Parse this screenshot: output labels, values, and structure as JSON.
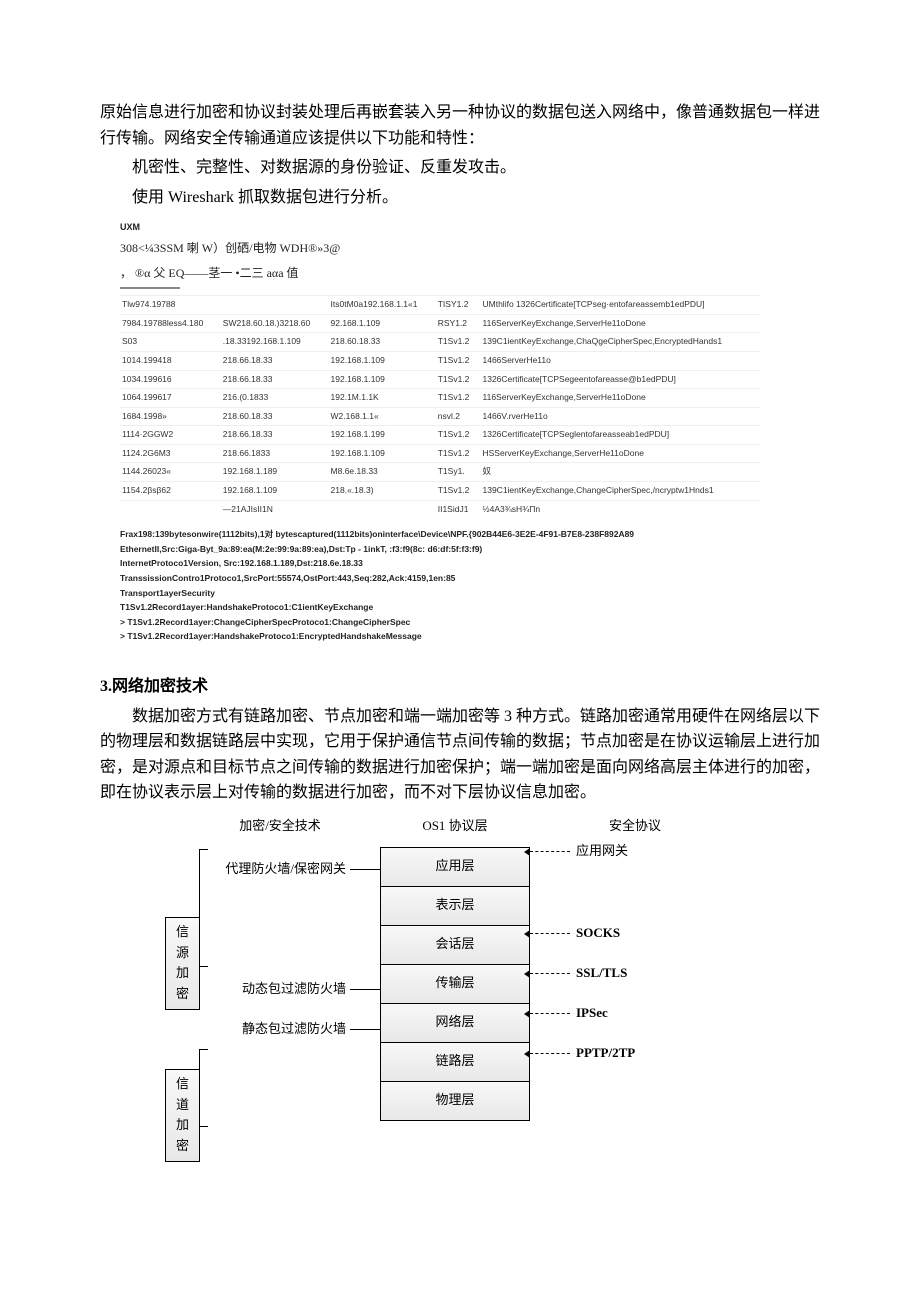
{
  "intro": {
    "p1": "原始信息进行加密和协议封装处理后再嵌套装入另一种协议的数据包送入网络中，像普通数据包一样进行传输。网络安全传输通道应该提供以下功能和特性：",
    "p2": "机密性、完整性、对数据源的身份验证、反重发攻击。",
    "p3": "使用 Wireshark 抓取数据包进行分析。"
  },
  "wireshark": {
    "top": "UXM",
    "toolbar": "308<¼3SSM 喇 W）创硒/电物 WDH®»3@",
    "filter": "， ®α 父 EQ——茎一 •二三 aαa 值",
    "packets": [
      {
        "no": "Tlw974.19788",
        "src": "",
        "dst": "Its0tM0a192.168.1.1«1",
        "proto": "TISY1.2",
        "len": "",
        "info": "UMthlifo 1326Certificate[TCPseg·entofareassemb1edPDU]"
      },
      {
        "no": "7984.19788less4.180",
        "src": "SW218.60.18.)3218.60",
        "dst": "92.168.1.109",
        "proto": "RSY1.2",
        "len": "",
        "info": "116ServerKeyExchange,ServerHe11oDone"
      },
      {
        "no": "S03",
        "src": ".18.33192.168.1.109",
        "dst": "218.60.18.33",
        "proto": "T1Sv1.2",
        "len": "",
        "info": "139C1ientKeyExchange,ChaQgeCipherSpec,EncryptedHands1"
      },
      {
        "no": "1014.199418",
        "src": "218.66.18.33",
        "dst": "192.168.1.109",
        "proto": "T1Sv1.2",
        "len": "",
        "info": "1466ServerHe11o"
      },
      {
        "no": "1034.199616",
        "src": "218.66.18.33",
        "dst": "192.168.1.109",
        "proto": "T1Sv1.2",
        "len": "",
        "info": "1326Certificate[TCPSegeentofareasse@b1edPDU]"
      },
      {
        "no": "1064.199617",
        "src": "216.(0.1833",
        "dst": "192.1M.1.1K",
        "proto": "T1Sv1.2",
        "len": "",
        "info": "116ServerKeyExchange,ServerHe11oDone"
      },
      {
        "no": "1684.1998»",
        "src": "218.60.18.33",
        "dst": "W2.168.1.1«",
        "proto": "nsvl.2",
        "len": "",
        "info": "1466V.rverHe11o"
      },
      {
        "no": "1114·2GGW2",
        "src": "218.66.18.33",
        "dst": "192.168.1.199",
        "proto": "T1Sv1.2",
        "len": "",
        "info": "1326Certificate[TCPSeglentofareasseab1edPDU]"
      },
      {
        "no": "1124.2G6M3",
        "src": "218.66.1833",
        "dst": "192.168.1.109",
        "proto": "T1Sv1.2",
        "len": "",
        "info": "HSServerKeyExchange,ServerHe11oDone"
      },
      {
        "no": "1144.26023«",
        "src": "192.168.1.189",
        "dst": "M8.6e.18.33",
        "proto": "T1Sy1.",
        "len": "",
        "info": "奴"
      },
      {
        "no": "1154.2βsβ62",
        "src": "192.168.1.109",
        "dst": "218.«.18.3)",
        "proto": "T1Sv1.2",
        "len": "",
        "info": "139C1ientKeyExchange,ChangeCipherSpec,/ncryptw1Hnds1"
      },
      {
        "no": "",
        "src": "—21AJIsII1N",
        "dst": "",
        "proto": "II1SidJ1",
        "len": "",
        "info": "½4A3¾sH¾Πn"
      }
    ],
    "details": [
      "Frax198:139bytesonwire(1112bits),1对  bytescaptured(1112bits)oninterface\\Device\\NPF.{902B44E6-3E2E-4F91-B7E8-238F892A89",
      "EthernetII,Src:Giga-Byt_9a:89:ea(M:2e:99:9a:89:ea),Dst:Tp - 1inkT,   :f3:f9(8c:  d6:df:5f:f3:f9)",
      "InternetProtoco1Version,   Src:192.168.1.189,Dst:218.6e.18.33",
      "TranssissionContro1Protoco1,SrcPort:55574,OstPort:443,Seq:282,Ack:4159,1en:85",
      "Transport1ayerSecurity",
      "     T1Sv1.2Record1ayer:HandshakeProtoco1:C1ientKeyExchange",
      ">    T1Sv1.2Record1ayer:ChangeCipherSpecProtoco1:ChangeCipherSpec",
      ">    T1Sv1.2Record1ayer:HandshakeProtoco1:EncryptedHandshakeMessage"
    ]
  },
  "section3": {
    "title": "3.网络加密技术",
    "body": "数据加密方式有链路加密、节点加密和端一端加密等 3 种方式。链路加密通常用硬件在网络层以下的物理层和数据链路层中实现，它用于保护通信节点间传输的数据；节点加密是在协议运输层上进行加密，是对源点和目标节点之间传输的数据进行加密保护；端一端加密是面向网络高层主体进行的加密，即在协议表示层上对传输的数据进行加密，而不对下层协议信息加密。"
  },
  "diagram": {
    "headers": {
      "left": "加密/安全技术",
      "mid": "OS1 协议层",
      "right": "安全协议"
    },
    "osi": [
      "应用层",
      "表示层",
      "会话层",
      "传输层",
      "网络层",
      "链路层",
      "物理层"
    ],
    "left": {
      "proxy": "代理防火墙/保密网关",
      "src_enc": "信源加密",
      "dyn_fw": "动态包过滤防火墙",
      "static_fw": "静态包过滤防火墙",
      "chan_enc": "信道加密"
    },
    "right": {
      "app_gw": "应用网关",
      "socks": "SOCKS",
      "ssl": "SSL/TLS",
      "ipsec": "IPSec",
      "pptp": "PPTP/2TP"
    }
  }
}
